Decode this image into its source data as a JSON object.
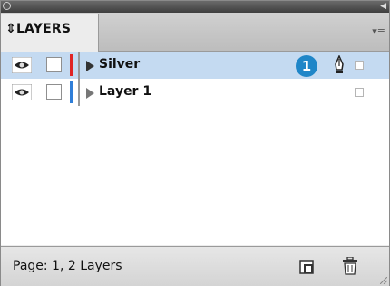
{
  "panel": {
    "tab_label": "LAYERS",
    "tab_arrow": "⬍"
  },
  "layers": [
    {
      "name": "Silver",
      "selected": true,
      "color": "#e02424",
      "visible": true,
      "locked": false,
      "badge": "1",
      "icons": [
        "eye-icon",
        "pen-icon"
      ]
    },
    {
      "name": "Layer 1",
      "selected": false,
      "color": "#2f7ed8",
      "visible": true,
      "locked": false,
      "icons": [
        "eye-icon"
      ]
    }
  ],
  "footer": {
    "status": "Page: 1, 2 Layers"
  },
  "colors": {
    "selection": "#c4daf1",
    "badge": "#1f86c8"
  }
}
